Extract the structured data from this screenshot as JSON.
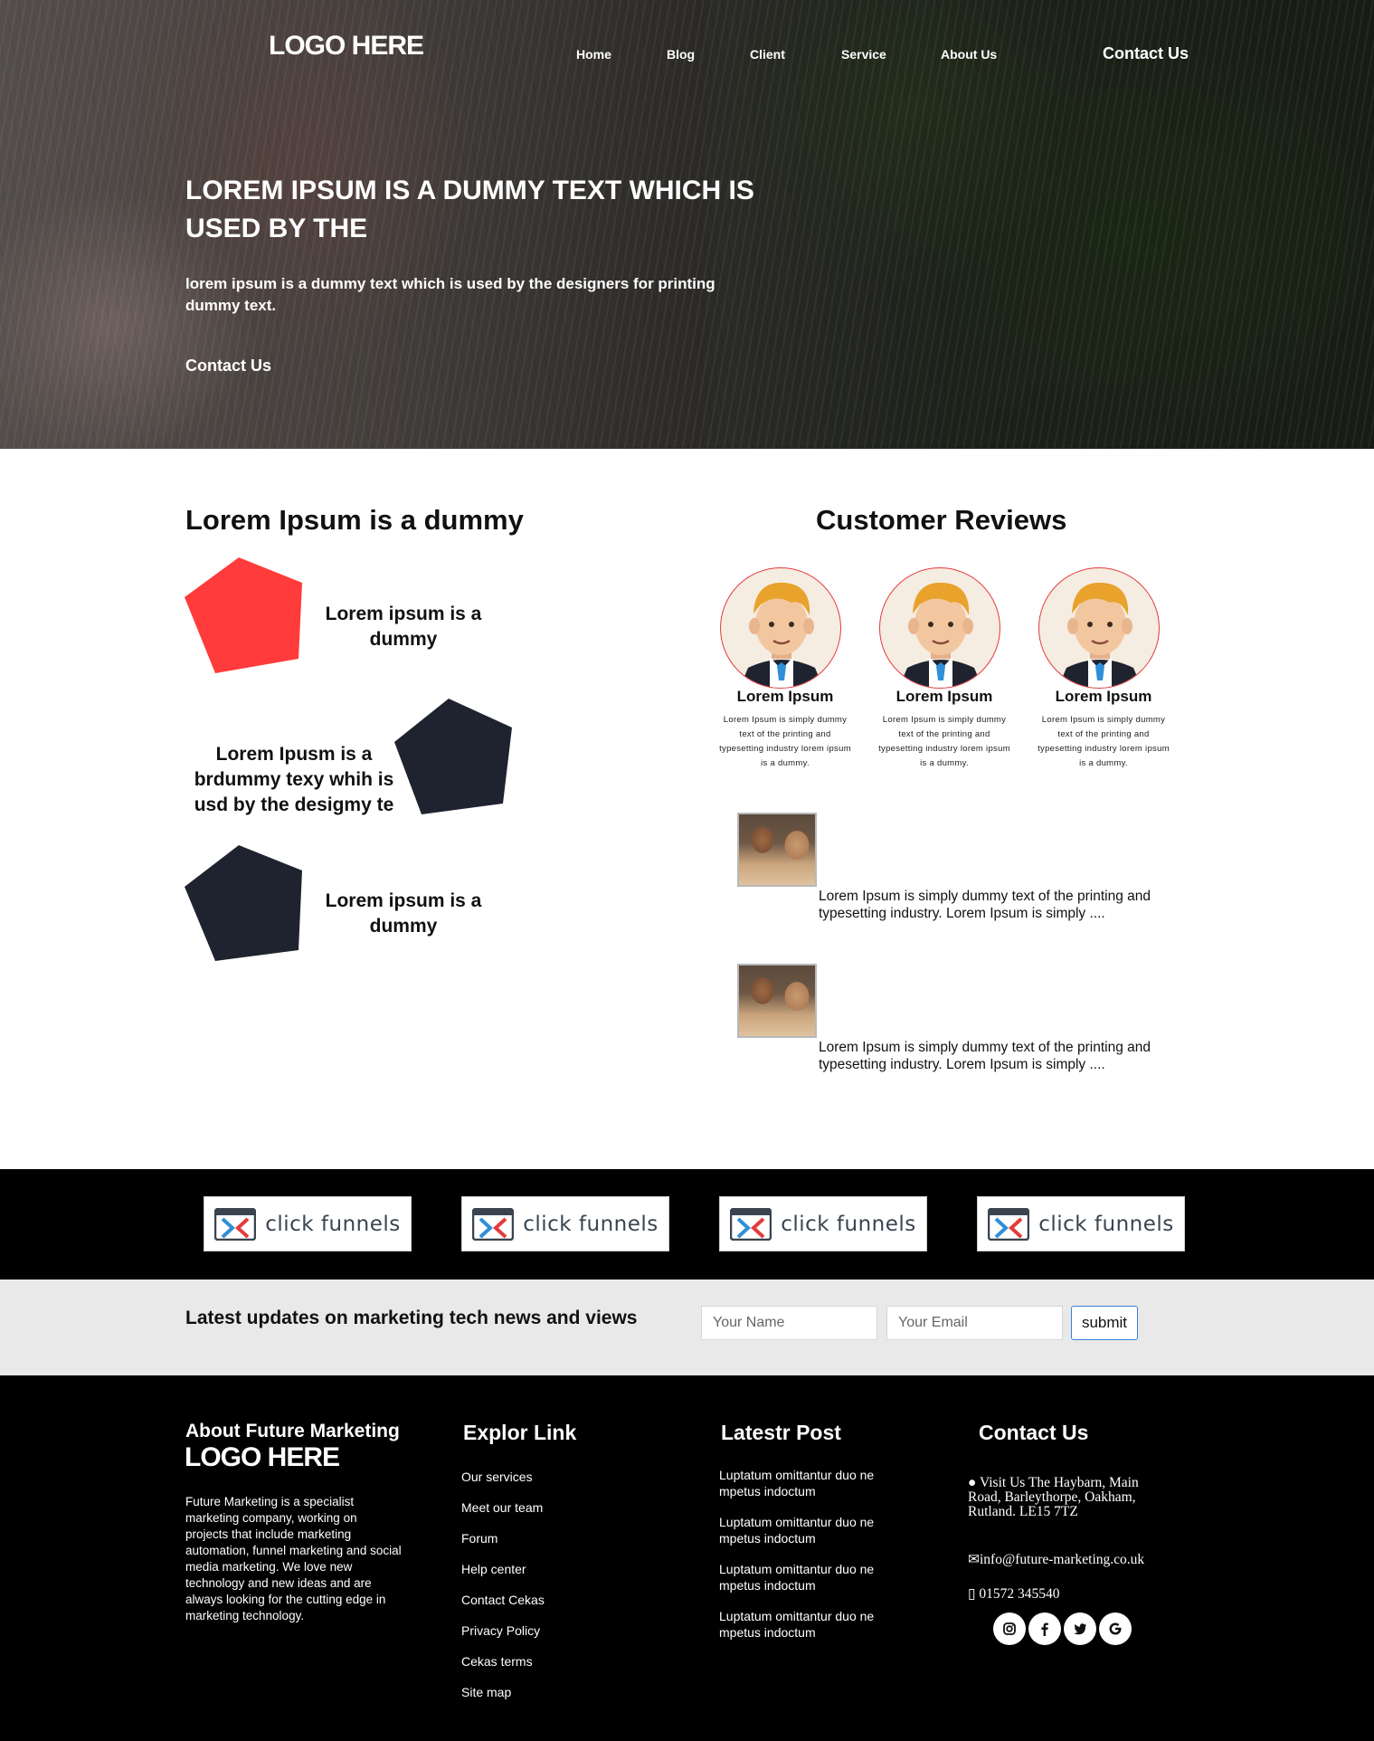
{
  "header": {
    "logo": "LOGO HERE",
    "nav": [
      {
        "label": "Home"
      },
      {
        "label": "Blog"
      },
      {
        "label": "Client"
      },
      {
        "label": "Service"
      },
      {
        "label": "About Us"
      }
    ],
    "contact_label": "Contact Us"
  },
  "hero": {
    "title": "LOREM IPSUM IS A DUMMY TEXT WHICH IS USED BY THE",
    "subtitle": "lorem ipsum is a dummy text which is used by the designers for printing dummy text.",
    "cta_label": "Contact Us"
  },
  "features": {
    "title": "Lorem Ipsum is a dummy",
    "items": [
      {
        "label": "Lorem ipsum is a dummy",
        "color": "#ff3b3b"
      },
      {
        "label": "Lorem Ipusm is a brdummy texy whih is usd by the desigmy te",
        "color": "#1f2330"
      },
      {
        "label": "Lorem ipsum is a dummy",
        "color": "#1f2330"
      }
    ]
  },
  "reviews": {
    "title": "Customer Reviews",
    "items": [
      {
        "name": "Lorem Ipsum",
        "text": "Lorem Ipsum is simply dummy text of the printing and typesetting industry lorem ipsum is a dummy."
      },
      {
        "name": "Lorem Ipsum",
        "text": "Lorem Ipsum is simply dummy text of the printing and typesetting industry lorem ipsum is a dummy."
      },
      {
        "name": "Lorem Ipsum",
        "text": "Lorem Ipsum is simply dummy text of the printing and typesetting industry lorem ipsum is a dummy."
      }
    ],
    "posts": [
      {
        "text": "Lorem Ipsum is simply dummy text of the printing and typesetting industry. Lorem Ipsum is simply ...."
      },
      {
        "text": "Lorem Ipsum is simply dummy text of the printing and typesetting industry. Lorem Ipsum is simply ...."
      }
    ]
  },
  "brands": [
    {
      "label": "click funnels"
    },
    {
      "label": "click funnels"
    },
    {
      "label": "click funnels"
    },
    {
      "label": "click funnels"
    }
  ],
  "newsletter": {
    "title": "Latest updates on marketing tech news and views",
    "name_placeholder": "Your Name",
    "email_placeholder": "Your Email",
    "submit_label": "submit"
  },
  "footer": {
    "about_heading": "About Future Marketing",
    "logo": "LOGO HERE",
    "about_text": "Future Marketing is a specialist marketing company, working on projects that include marketing automation, funnel marketing and social media marketing. We love new technology and new ideas and are always looking for the cutting edge in marketing technology.",
    "links_heading": "Explor Link",
    "links": [
      {
        "label": "Our services"
      },
      {
        "label": "Meet our team"
      },
      {
        "label": "Forum"
      },
      {
        "label": "Help center"
      },
      {
        "label": "Contact Cekas"
      },
      {
        "label": "Privacy Policy"
      },
      {
        "label": "Cekas terms"
      },
      {
        "label": "Site map"
      }
    ],
    "posts_heading": "Latestr Post",
    "posts": [
      {
        "label": "Luptatum omittantur duo ne mpetus indoctum"
      },
      {
        "label": "Luptatum omittantur duo ne mpetus indoctum"
      },
      {
        "label": "Luptatum omittantur duo ne mpetus indoctum"
      },
      {
        "label": "Luptatum omittantur duo ne mpetus indoctum"
      }
    ],
    "contact_heading": "Contact Us",
    "address": "Visit Us The Haybarn, Main Road, Barleythorpe, Oakham, Rutland. LE15 7TZ",
    "email": "info@future-marketing.co.uk",
    "phone": "01572 345540",
    "social_icons": [
      "instagram-icon",
      "facebook-icon",
      "twitter-icon",
      "google-icon"
    ]
  }
}
